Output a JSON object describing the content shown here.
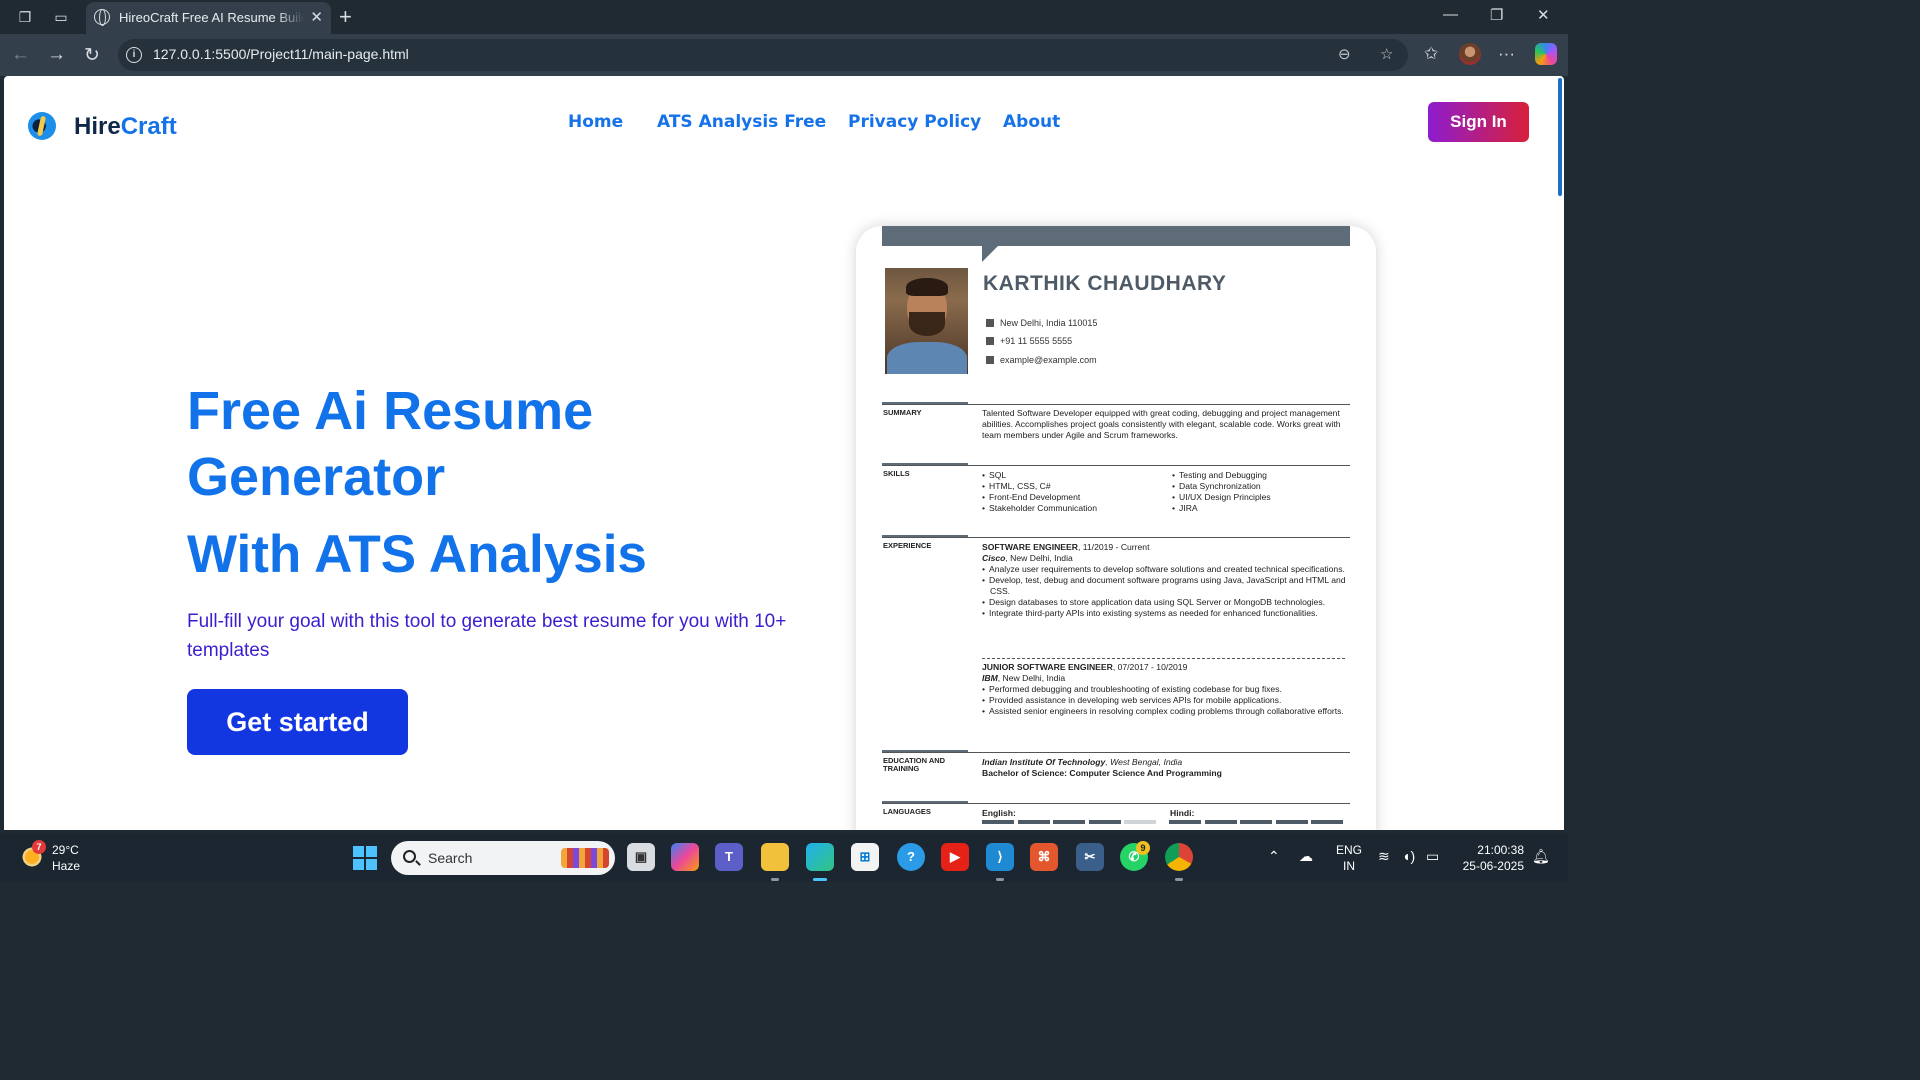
{
  "browser": {
    "tab_title": "HireoCraft Free AI Resume Builder",
    "url": "127.0.0.1:5500/Project11/main-page.html",
    "new_tab_label": "+"
  },
  "site": {
    "logo_part1": "Hire",
    "logo_part2": "Craft",
    "nav": [
      "Home",
      "ATS Analysis Free",
      "Privacy Policy",
      "About"
    ],
    "signin_label": "Sign In",
    "accent_color": "#1172ea",
    "cta_color": "#1236e0"
  },
  "hero": {
    "title": "Free Ai Resume Generator",
    "subtitle": "With ATS Analysis",
    "description": "Full-fill your goal with this tool to generate best resume for you with 10+ templates",
    "cta_label": "Get started"
  },
  "resume": {
    "name": "KARTHIK CHAUDHARY",
    "address": "New Delhi, India 110015",
    "phone": "+91 11 5555 5555",
    "email": "example@example.com",
    "summary_label": "SUMMARY",
    "summary": "Talented Software Developer equipped with great coding, debugging and project management abilities. Accomplishes project goals consistently with elegant, scalable code. Works great with team members under Agile and Scrum frameworks.",
    "skills_label": "SKILLS",
    "skills_left": [
      "SQL",
      "HTML, CSS, C#",
      "Front-End Development",
      "Stakeholder Communication"
    ],
    "skills_right": [
      "Testing and Debugging",
      "Data Synchronization",
      "UI/UX Design Principles",
      "JIRA"
    ],
    "experience_label": "EXPERIENCE",
    "job1_title": "SOFTWARE ENGINEER",
    "job1_dates": ", 11/2019 - Current",
    "job1_company": "Cisco",
    "job1_location": ", New Delhi, India",
    "job1_bullets": [
      "Analyze user requirements to develop software solutions and created technical specifications.",
      "Develop, test, debug and document software programs using Java, JavaScript and HTML and CSS.",
      "Design databases to store application data using SQL Server or MongoDB technologies.",
      "Integrate third-party APIs into existing systems as needed for enhanced functionalities."
    ],
    "job2_title": "JUNIOR SOFTWARE ENGINEER",
    "job2_dates": ", 07/2017 - 10/2019",
    "job2_company": "IBM",
    "job2_location": ", New Delhi, India",
    "job2_bullets": [
      "Performed debugging and troubleshooting of existing codebase for bug fixes.",
      "Provided assistance in developing web services APIs for mobile applications.",
      "Assisted senior engineers in resolving complex coding problems through collaborative efforts."
    ],
    "education_label": "EDUCATION AND TRAINING",
    "school": "Indian Institute Of Technology",
    "school_location": ", West Bengal, India",
    "degree": "Bachelor of Science: Computer Science And Programming",
    "languages_label": "LANGUAGES",
    "lang1": "English:",
    "lang2": "Hindi:",
    "lang1_level": 0.8,
    "lang2_level": 1.0
  },
  "taskbar": {
    "weather_temp": "29°C",
    "weather_desc": "Haze",
    "weather_badge": "7",
    "search_label": "Search",
    "whatsapp_badge": "9",
    "lang_line1": "ENG",
    "lang_line2": "IN",
    "time": "21:00:38",
    "date": "25-06-2025"
  }
}
